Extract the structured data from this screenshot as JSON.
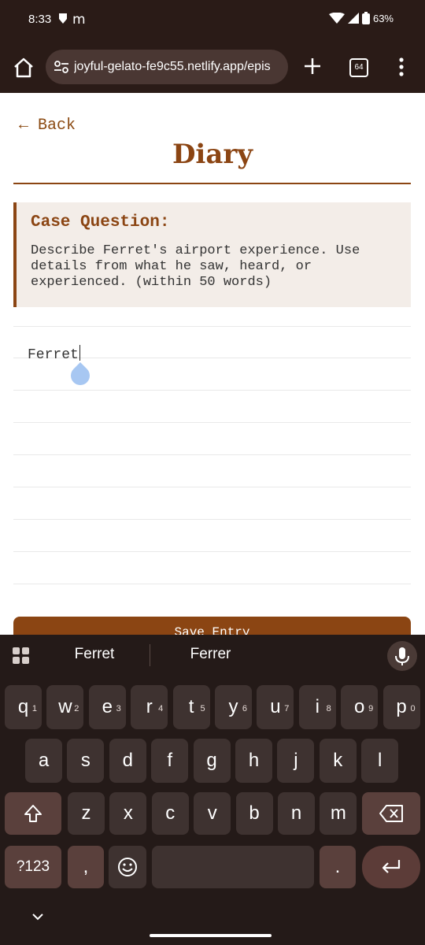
{
  "status": {
    "time": "8:33",
    "battery": "63%"
  },
  "browser": {
    "url": "joyful-gelato-fe9c55.netlify.app/epis",
    "tab_count": "64"
  },
  "page": {
    "back_label": "← Back",
    "title": "Diary",
    "case_heading": "Case Question:",
    "case_body": "Describe Ferret's airport experience. Use details from what he saw, heard, or experienced. (within 50 words)",
    "entry_text": "Ferret",
    "save_label": "Save Entry"
  },
  "keyboard": {
    "suggestions": [
      "Ferret",
      "Ferrer"
    ],
    "row1": [
      {
        "k": "q",
        "n": "1"
      },
      {
        "k": "w",
        "n": "2"
      },
      {
        "k": "e",
        "n": "3"
      },
      {
        "k": "r",
        "n": "4"
      },
      {
        "k": "t",
        "n": "5"
      },
      {
        "k": "y",
        "n": "6"
      },
      {
        "k": "u",
        "n": "7"
      },
      {
        "k": "i",
        "n": "8"
      },
      {
        "k": "o",
        "n": "9"
      },
      {
        "k": "p",
        "n": "0"
      }
    ],
    "row2": [
      "a",
      "s",
      "d",
      "f",
      "g",
      "h",
      "j",
      "k",
      "l"
    ],
    "row3": [
      "z",
      "x",
      "c",
      "v",
      "b",
      "n",
      "m"
    ],
    "symbols_label": "?123",
    "comma_label": ",",
    "period_label": "."
  }
}
